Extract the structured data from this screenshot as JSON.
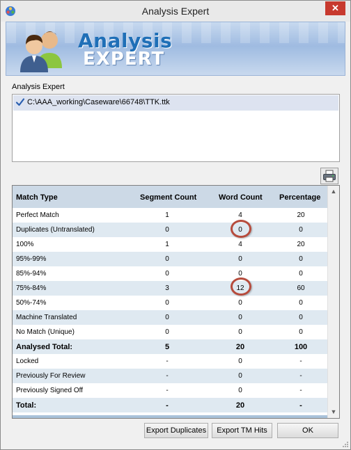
{
  "window": {
    "title": "Analysis Expert",
    "close_label": "✕"
  },
  "banner": {
    "title_line1": "Analysis",
    "title_line2": "EXPERT"
  },
  "files": {
    "group_label": "Analysis Expert",
    "items": [
      {
        "path": "C:\\AAA_working\\Caseware\\66748\\TTK.ttk",
        "checked": true
      }
    ]
  },
  "grid": {
    "headers": {
      "match_type": "Match Type",
      "segment_count": "Segment Count",
      "word_count": "Word Count",
      "percentage": "Percentage"
    },
    "rows": [
      {
        "type": "Perfect Match",
        "segments": "1",
        "words": "4",
        "pct": "20"
      },
      {
        "type": "Duplicates (Untranslated)",
        "segments": "0",
        "words": "0",
        "pct": "0"
      },
      {
        "type": "100%",
        "segments": "1",
        "words": "4",
        "pct": "20"
      },
      {
        "type": "95%-99%",
        "segments": "0",
        "words": "0",
        "pct": "0"
      },
      {
        "type": "85%-94%",
        "segments": "0",
        "words": "0",
        "pct": "0"
      },
      {
        "type": "75%-84%",
        "segments": "3",
        "words": "12",
        "pct": "60"
      },
      {
        "type": "50%-74%",
        "segments": "0",
        "words": "0",
        "pct": "0"
      },
      {
        "type": "Machine Translated",
        "segments": "0",
        "words": "0",
        "pct": "0"
      },
      {
        "type": "No Match (Unique)",
        "segments": "0",
        "words": "0",
        "pct": "0"
      },
      {
        "type": "Analysed Total:",
        "segments": "5",
        "words": "20",
        "pct": "100"
      },
      {
        "type": "Locked",
        "segments": "-",
        "words": "0",
        "pct": "-"
      },
      {
        "type": "Previously For Review",
        "segments": "-",
        "words": "0",
        "pct": "-"
      },
      {
        "type": "Previously Signed Off",
        "segments": "-",
        "words": "0",
        "pct": "-"
      },
      {
        "type": "Total:",
        "segments": "-",
        "words": "20",
        "pct": "-"
      }
    ]
  },
  "buttons": {
    "export_duplicates": "Export Duplicates",
    "export_tm_hits": "Export TM Hits",
    "ok": "OK"
  },
  "colors": {
    "header_bg": "#ccd9e6",
    "row_alt": "#dfe9f1",
    "highlight": "#b64b3c",
    "close": "#c7392e"
  }
}
